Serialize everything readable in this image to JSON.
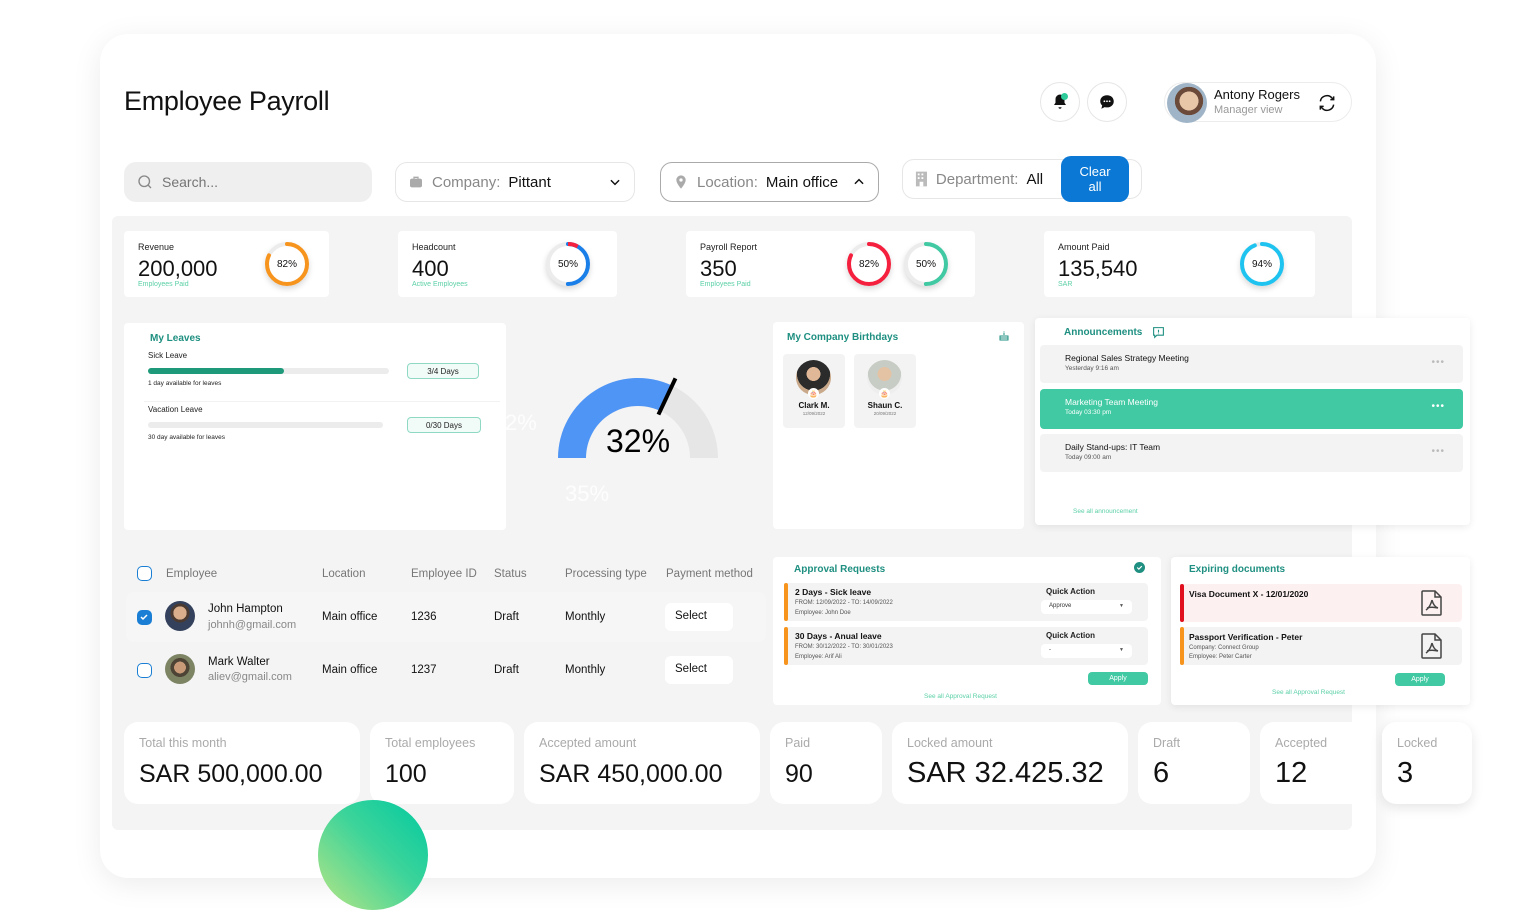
{
  "header": {
    "title": "Employee Payroll",
    "notifications_icon": "bell-icon",
    "messages_icon": "chat-bubble-icon",
    "user": {
      "name": "Antony Rogers",
      "role": "Manager view",
      "switch_icon": "refresh-icon"
    }
  },
  "filters": {
    "search_placeholder": "Search...",
    "company": {
      "label": "Company:",
      "value": "Pittant",
      "icon": "briefcase-icon"
    },
    "location": {
      "label": "Location:",
      "value": "Main office",
      "icon": "location-pin-icon"
    },
    "department": {
      "label": "Department:",
      "value": "All",
      "icon": "building-icon"
    },
    "clear_label": "Clear all"
  },
  "kpis": [
    {
      "title": "Revenue",
      "value": "200,000",
      "sub": "Employees Paid",
      "rings": [
        {
          "percent": 82,
          "label": "82%",
          "color": "#f7941d"
        }
      ]
    },
    {
      "title": "Headcount",
      "value": "400",
      "sub": "Active Employees",
      "rings": [
        {
          "percent": 50,
          "label": "50%",
          "color": "#1a7fe8",
          "accent": "#f5203e"
        }
      ]
    },
    {
      "title": "Payroll Report",
      "value": "350",
      "sub": "Employees Paid",
      "rings": [
        {
          "percent": 82,
          "label": "82%",
          "color": "#f5203e"
        },
        {
          "percent": 50,
          "label": "50%",
          "color": "#40c9a2"
        }
      ]
    },
    {
      "title": "Amount Paid",
      "value": "135,540",
      "sub": "SAR",
      "rings": [
        {
          "percent": 94,
          "label": "94%",
          "color": "#1fc3f0"
        }
      ]
    }
  ],
  "leaves": {
    "title": "My Leaves",
    "items": [
      {
        "label": "Sick Leave",
        "used": 3,
        "total": 4,
        "pill": "3/4 Days",
        "note": "1 day available for leaves"
      },
      {
        "label": "Vacation Leave",
        "used": 0,
        "total": 30,
        "pill": "0/30 Days",
        "note": "30 day available for leaves"
      }
    ]
  },
  "gauge": {
    "value": 32,
    "label": "32%",
    "ghost_labels": [
      "2%",
      "35%"
    ],
    "color": "#4f95f5"
  },
  "birthdays": {
    "title": "My Company Birthdays",
    "icon": "cake-icon",
    "people": [
      {
        "name": "Clark M.",
        "date": "12/09/2022"
      },
      {
        "name": "Shaun C.",
        "date": "20/09/2022"
      }
    ]
  },
  "announcements": {
    "title": "Announcements",
    "icon": "message-alert-icon",
    "items": [
      {
        "title": "Regional Sales Strategy Meeting",
        "time": "Yesterday 9:16 am",
        "active": false
      },
      {
        "title": "Marketing Team Meeting",
        "time": "Today 03:30 pm",
        "active": true
      },
      {
        "title": "Daily Stand-ups: IT Team",
        "time": "Today 09:00 am",
        "active": false
      }
    ],
    "see_all": "See all announcement"
  },
  "employees_table": {
    "columns": [
      "Employee",
      "Location",
      "Employee ID",
      "Status",
      "Processing type",
      "Payment method"
    ],
    "rows": [
      {
        "checked": true,
        "name": "John Hampton",
        "email": "johnh@gmail.com",
        "location": "Main office",
        "id": "1236",
        "status": "Draft",
        "processing": "Monthly",
        "payment": "Select"
      },
      {
        "checked": false,
        "name": "Mark Walter",
        "email": "aliev@gmail.com",
        "location": "Main office",
        "id": "1237",
        "status": "Draft",
        "processing": "Monthly",
        "payment": "Select"
      }
    ]
  },
  "approvals": {
    "title": "Approval Requests",
    "items": [
      {
        "title": "2 Days - Sick leave",
        "dates": "FROM: 12/09/2022 - TO: 14/09/2022",
        "employee": "Employee: John Doe",
        "action_label": "Quick Action",
        "action_value": "Approve"
      },
      {
        "title": "30 Days - Anual leave",
        "dates": "FROM: 30/12/2022 - TO: 30/01/2023",
        "employee": "Employee: Arif Ali",
        "action_label": "Quick Action",
        "action_value": "-"
      }
    ],
    "apply_label": "Apply",
    "see_all": "See all Approval Request"
  },
  "documents": {
    "title": "Expiring documents",
    "items": [
      {
        "title": "Visa Document X - 12/01/2020",
        "lines": [],
        "severity_color": "#e0101e",
        "bg": "#fdf0f0"
      },
      {
        "title": "Passport Verification - Peter",
        "lines": [
          "Company: Connect Group",
          "Employee: Peter Carter"
        ],
        "severity_color": "#f7941d",
        "bg": "#f3f3f3"
      }
    ],
    "apply_label": "Apply",
    "see_all": "See all Approval Request"
  },
  "stats": [
    {
      "label": "Total this month",
      "value": "SAR 500,000.00"
    },
    {
      "label": "Total employees",
      "value": "100"
    },
    {
      "label": "Accepted amount",
      "value": "SAR 450,000.00"
    },
    {
      "label": "Paid",
      "value": "90"
    },
    {
      "label": "Locked amount",
      "value": "SAR 32.425.32"
    },
    {
      "label": "Draft",
      "value": "6"
    },
    {
      "label": "Accepted",
      "value": "12"
    },
    {
      "label": "Locked",
      "value": "3"
    }
  ]
}
